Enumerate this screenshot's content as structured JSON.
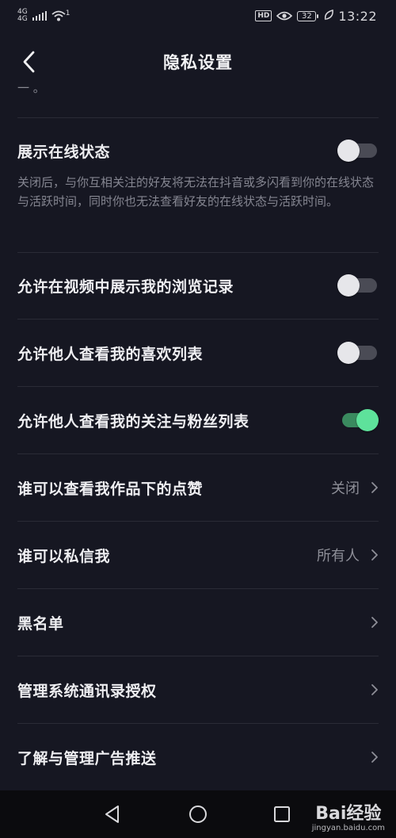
{
  "status_bar": {
    "network_type": "4G",
    "network_sub": "4G",
    "wifi_badge": "1",
    "hd_label": "HD",
    "battery_level": "32",
    "time": "13:22"
  },
  "header": {
    "title": "隐私设置"
  },
  "settings": {
    "online_status": {
      "label": "展示在线状态",
      "description": "关闭后，与你互相关注的好友将无法在抖音或多闪看到你的在线状态与活跃时间，同时你也无法查看好友的在线状态与活跃时间。",
      "enabled": false
    },
    "browse_history": {
      "label": "允许在视频中展示我的浏览记录",
      "enabled": false
    },
    "likes_list": {
      "label": "允许他人查看我的喜欢列表",
      "enabled": false
    },
    "follow_fans_list": {
      "label": "允许他人查看我的关注与粉丝列表",
      "enabled": true
    },
    "likes_visibility": {
      "label": "谁可以查看我作品下的点赞",
      "value": "关闭"
    },
    "direct_message": {
      "label": "谁可以私信我",
      "value": "所有人"
    },
    "blacklist": {
      "label": "黑名单"
    },
    "contacts_auth": {
      "label": "管理系统通讯录授权"
    },
    "ad_push": {
      "label": "了解与管理广告推送"
    }
  },
  "watermark": {
    "main": "Bai经验",
    "sub": "jingyan.baidu.com"
  },
  "colors": {
    "background": "#161722",
    "toggle_on": "#5ee29b",
    "toggle_off_track": "#4a4b55"
  }
}
